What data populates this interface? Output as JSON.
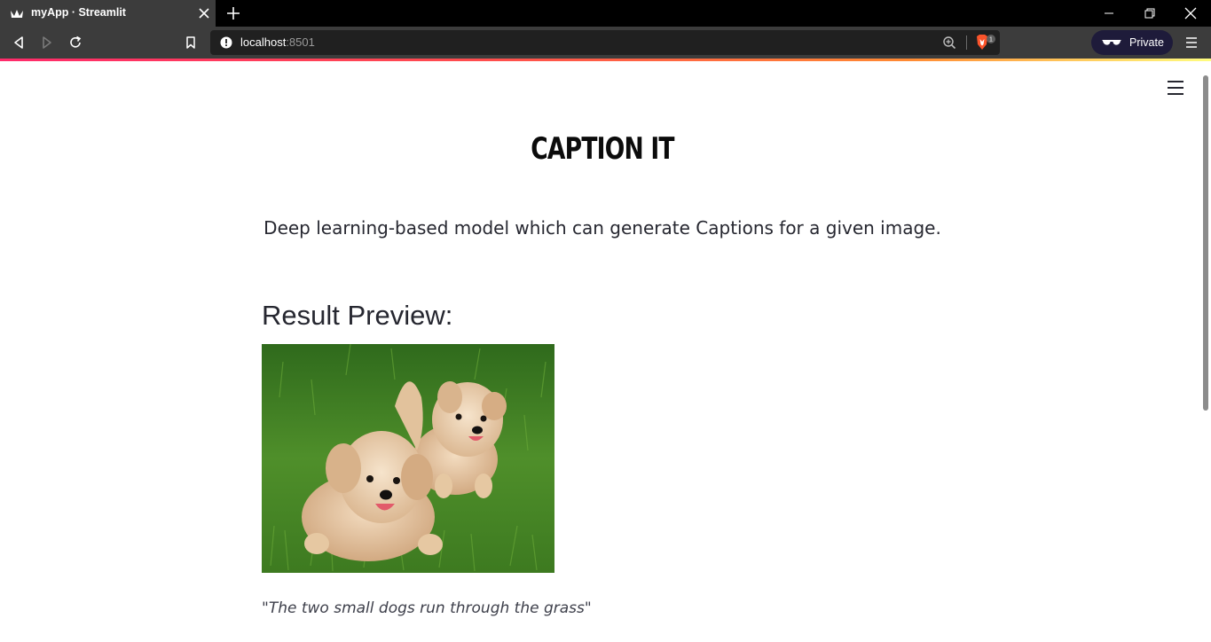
{
  "browser": {
    "tab_title": "myApp · Streamlit",
    "url_host": "localhost",
    "url_port": ":8501",
    "private_label": "Private",
    "shields_badge": "1"
  },
  "app": {
    "title": "CAPTION IT",
    "subtitle": "Deep learning-based model which can generate Captions for a given image.",
    "section_heading": "Result Preview:",
    "caption_quote_open": "\"",
    "caption_text": "The two small dogs run through the grass",
    "caption_quote_close": "\""
  },
  "colors": {
    "text_dark": "#262730",
    "grass": "#4f8f2a",
    "dog_fur": "#e8c9a4",
    "accent_gradient": [
      "#ff2b6b",
      "#ff8a33",
      "#fffd80"
    ]
  },
  "icons": {
    "tab_favicon": "streamlit-crown-icon",
    "tab_close": "close-icon",
    "new_tab": "plus-icon",
    "back": "back-arrow-icon",
    "forward": "forward-arrow-icon",
    "reload": "reload-icon",
    "bookmark": "bookmark-icon",
    "site_info": "info-circle-icon",
    "zoom": "zoom-icon",
    "shields": "brave-shields-icon",
    "private": "private-glasses-icon",
    "menu": "hamburger-menu-icon"
  }
}
